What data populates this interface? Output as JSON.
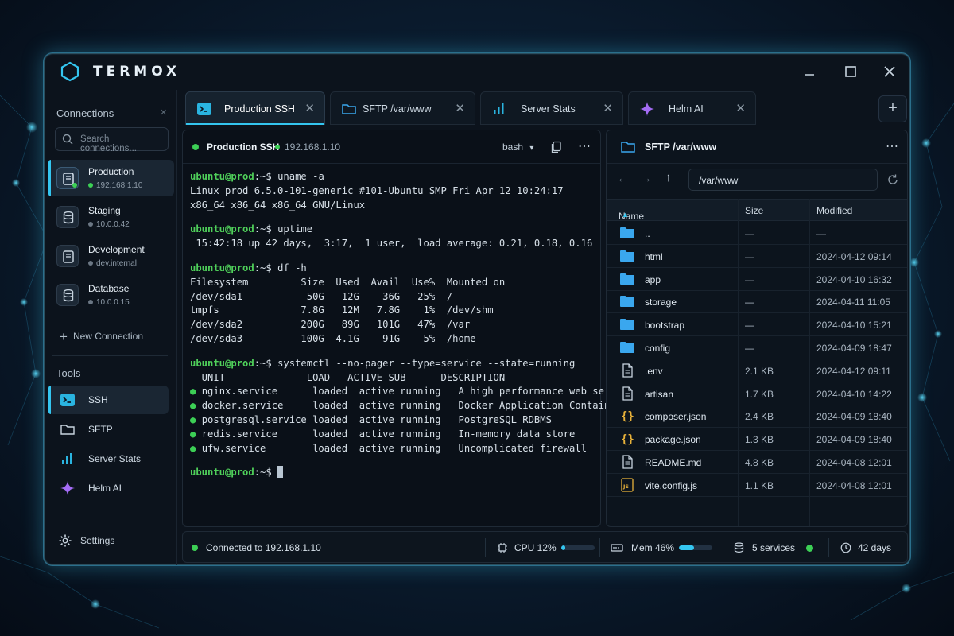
{
  "app": {
    "title": "TERMOX"
  },
  "sidebar": {
    "connections_label": "Connections",
    "search_placeholder": "Search connections...",
    "connections": [
      {
        "name": "Production",
        "address": "192.168.1.10",
        "status": "online"
      },
      {
        "name": "Staging",
        "address": "10.0.0.42",
        "status": "offline"
      },
      {
        "name": "Development",
        "address": "dev.internal",
        "status": "offline"
      },
      {
        "name": "Database",
        "address": "10.0.0.15",
        "status": "offline"
      }
    ],
    "new_connection": "New Connection",
    "tools_label": "Tools",
    "tools": [
      {
        "label": "SSH",
        "icon": "terminal-icon"
      },
      {
        "label": "SFTP",
        "icon": "folder-icon"
      },
      {
        "label": "Server Stats",
        "icon": "bar-chart-icon"
      },
      {
        "label": "Helm AI",
        "icon": "sparkle-icon"
      }
    ],
    "settings": "Settings"
  },
  "tabs": [
    {
      "label": "Production SSH",
      "icon": "terminal-icon",
      "active": true
    },
    {
      "label": "SFTP /var/www",
      "icon": "folder-icon",
      "active": false
    },
    {
      "label": "Server Stats",
      "icon": "bar-chart-icon",
      "active": false
    },
    {
      "label": "Helm AI",
      "icon": "sparkle-icon",
      "active": false
    }
  ],
  "terminal": {
    "title": "Production SSH",
    "address": "192.168.1.10",
    "shell": "bash",
    "prompt": "ubuntu@prod",
    "prompt_suffix": ":~$",
    "blocks": [
      {
        "command": "uname -a",
        "output": [
          "Linux prod 6.5.0-101-generic #101-Ubuntu SMP Fri Apr 12 10:24:17",
          "x86_64 x86_64 x86_64 GNU/Linux"
        ]
      },
      {
        "command": "uptime",
        "output": [
          " 15:42:18 up 42 days,  3:17,  1 user,  load average: 0.21, 0.18, 0.16"
        ]
      },
      {
        "command": "df -h",
        "output": [
          "Filesystem         Size  Used  Avail  Use%  Mounted on",
          "/dev/sda1           50G   12G    36G   25%  /",
          "tmpfs              7.8G   12M   7.8G    1%  /dev/shm",
          "/dev/sda2          200G   89G   101G   47%  /var",
          "/dev/sda3          100G  4.1G    91G    5%  /home"
        ]
      },
      {
        "command": "systemctl --no-pager --type=service --state=running",
        "output": []
      }
    ],
    "services_header": "  UNIT              LOAD   ACTIVE SUB      DESCRIPTION",
    "services": [
      "nginx.service      loaded  active running   A high performance web server",
      "docker.service     loaded  active running   Docker Application Container",
      "postgresql.service loaded  active running   PostgreSQL RDBMS",
      "redis.service      loaded  active running   In-memory data store",
      "ufw.service        loaded  active running   Uncomplicated firewall"
    ]
  },
  "sftp": {
    "title": "SFTP /var/www",
    "path": "/var/www",
    "columns": {
      "name": "Name",
      "size": "Size",
      "modified": "Modified"
    },
    "files": [
      {
        "name": "..",
        "size": "—",
        "modified": "—",
        "icon": "folder-icon"
      },
      {
        "name": "html",
        "size": "—",
        "modified": "2024-04-12 09:14",
        "icon": "folder-icon"
      },
      {
        "name": "app",
        "size": "—",
        "modified": "2024-04-10 16:32",
        "icon": "folder-icon"
      },
      {
        "name": "storage",
        "size": "—",
        "modified": "2024-04-11 11:05",
        "icon": "folder-icon"
      },
      {
        "name": "bootstrap",
        "size": "—",
        "modified": "2024-04-10 15:21",
        "icon": "folder-icon"
      },
      {
        "name": "config",
        "size": "—",
        "modified": "2024-04-09 18:47",
        "icon": "folder-icon"
      },
      {
        "name": ".env",
        "size": "2.1 KB",
        "modified": "2024-04-12 09:11",
        "icon": "file-icon"
      },
      {
        "name": "artisan",
        "size": "1.7 KB",
        "modified": "2024-04-10 14:22",
        "icon": "file-icon"
      },
      {
        "name": "composer.json",
        "size": "2.4 KB",
        "modified": "2024-04-09 18:40",
        "icon": "json-icon"
      },
      {
        "name": "package.json",
        "size": "1.3 KB",
        "modified": "2024-04-09 18:40",
        "icon": "json-icon"
      },
      {
        "name": "README.md",
        "size": "4.8 KB",
        "modified": "2024-04-08 12:01",
        "icon": "file-icon"
      },
      {
        "name": "vite.config.js",
        "size": "1.1 KB",
        "modified": "2024-04-08 12:01",
        "icon": "js-icon"
      }
    ]
  },
  "status": {
    "connection": "Connected to 192.168.1.10",
    "cpu_label": "CPU 12%",
    "cpu_value": 0.12,
    "mem_label": "Mem 46%",
    "mem_value": 0.46,
    "services": "5 services",
    "uptime": "42 days"
  },
  "colors": {
    "accent": "#34c6f0",
    "online": "#3ccf55",
    "prompt": "#4fd05a",
    "folder": "#3aa7ee",
    "json": "#e8b23a"
  }
}
